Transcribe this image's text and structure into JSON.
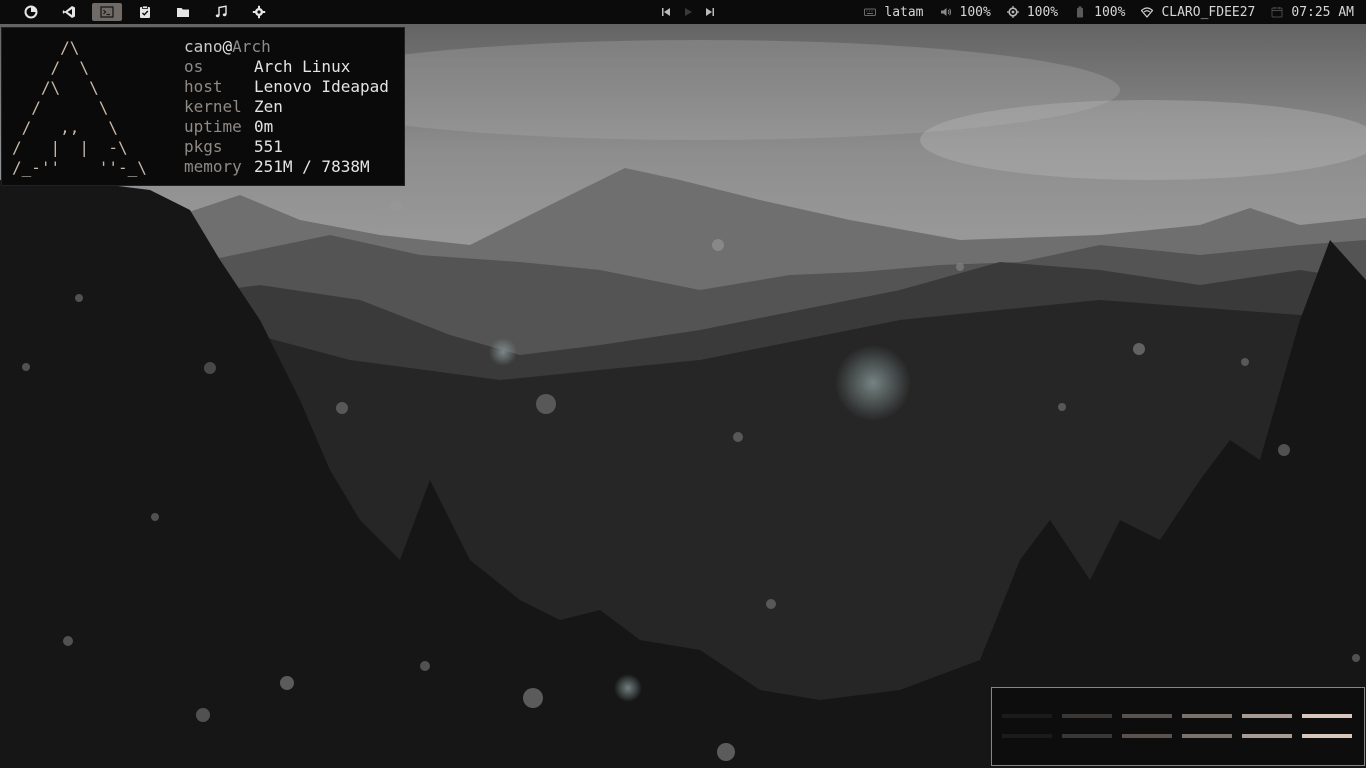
{
  "topbar": {
    "workspaces": [
      {
        "icon": "firefox-icon",
        "active": false
      },
      {
        "icon": "vscode-icon",
        "active": false
      },
      {
        "icon": "terminal-icon",
        "active": true
      },
      {
        "icon": "tasks-icon",
        "active": false
      },
      {
        "icon": "folder-icon",
        "active": false
      },
      {
        "icon": "music-icon",
        "active": false
      },
      {
        "icon": "settings-icon",
        "active": false
      }
    ],
    "media": [
      "previous-icon",
      "play-icon",
      "next-icon"
    ],
    "keyboard_layout": "latam",
    "volume": "100%",
    "brightness": "100%",
    "battery": "100%",
    "wifi_ssid": "CLARO_FDEE27",
    "clock": "07:25 AM"
  },
  "terminal": {
    "ascii_logo": "     /\\\n    /  \\\n   /\\   \\\n  /      \\\n /   ,,   \\\n/   |  |  -\\\n/_-''    ''-_\\",
    "user": "cano",
    "at": "@",
    "hostname": "Arch",
    "rows": [
      {
        "key": "os",
        "value": "Arch Linux"
      },
      {
        "key": "host",
        "value": "Lenovo Ideapad"
      },
      {
        "key": "kernel",
        "value": "Zen"
      },
      {
        "key": "uptime",
        "value": "0m"
      },
      {
        "key": "pkgs",
        "value": "551"
      },
      {
        "key": "memory",
        "value": "251M / 7838M"
      }
    ]
  },
  "palette": {
    "colors": [
      "#1c1b1b",
      "#3a3634",
      "#59524e",
      "#7c726c",
      "#a79b94",
      "#d8c6bc"
    ]
  },
  "colors": {
    "bar_bg": "#0b0b0b",
    "accent": "#c9b8a6",
    "active_workspace": "#6f6a66"
  }
}
